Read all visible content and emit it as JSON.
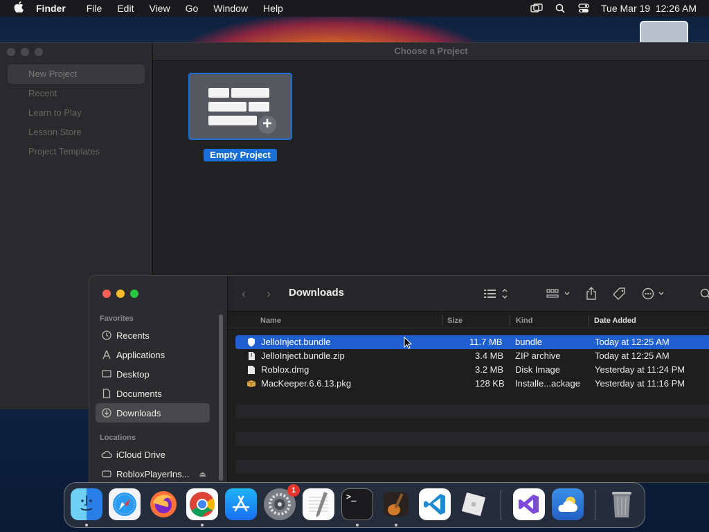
{
  "menubar": {
    "app_name": "Finder",
    "menus": [
      "File",
      "Edit",
      "View",
      "Go",
      "Window",
      "Help"
    ],
    "datetime": "Tue Mar 19  12:26 AM"
  },
  "playground": {
    "window_title": "Choose a Project",
    "sidebar": [
      "New Project",
      "Recent",
      "Learn to Play",
      "Lesson Store",
      "Project Templates"
    ],
    "selected_sidebar": "New Project",
    "template_label": "Empty Project"
  },
  "finder": {
    "folder_title": "Downloads",
    "favorites_label": "Favorites",
    "locations_label": "Locations",
    "favorites": [
      "Recents",
      "Applications",
      "Desktop",
      "Documents",
      "Downloads"
    ],
    "locations": [
      "iCloud Drive",
      "RobloxPlayerIns..."
    ],
    "columns": {
      "name": "Name",
      "size": "Size",
      "kind": "Kind",
      "date": "Date Added"
    },
    "files": [
      {
        "name": "JelloInject.bundle",
        "size": "11.7 MB",
        "kind": "bundle",
        "date": "Today at 12:25 AM",
        "icon": "shield-icon",
        "selected": true
      },
      {
        "name": "JelloInject.bundle.zip",
        "size": "3.4 MB",
        "kind": "ZIP archive",
        "date": "Today at 12:25 AM",
        "icon": "document-icon",
        "selected": false
      },
      {
        "name": "Roblox.dmg",
        "size": "3.2 MB",
        "kind": "Disk Image",
        "date": "Yesterday at 11:24 PM",
        "icon": "disk-image-icon",
        "selected": false
      },
      {
        "name": "MacKeeper.6.6.13.pkg",
        "size": "128 KB",
        "kind": "Installe...ackage",
        "date": "Yesterday at 11:16 PM",
        "icon": "package-icon",
        "selected": false
      }
    ]
  },
  "dock": {
    "apps": [
      "Finder",
      "Safari",
      "Firefox",
      "Chrome",
      "App Store",
      "System Settings",
      "TextEdit",
      "Terminal",
      "GarageBand",
      "Visual Studio Code",
      "Roblox",
      "Visual Studio",
      "Weather",
      "Trash"
    ],
    "settings_badge": "1"
  },
  "colors": {
    "accent": "#1f5fcf",
    "selection_blue": "#1a6fd6",
    "badge_red": "#e8352b"
  }
}
